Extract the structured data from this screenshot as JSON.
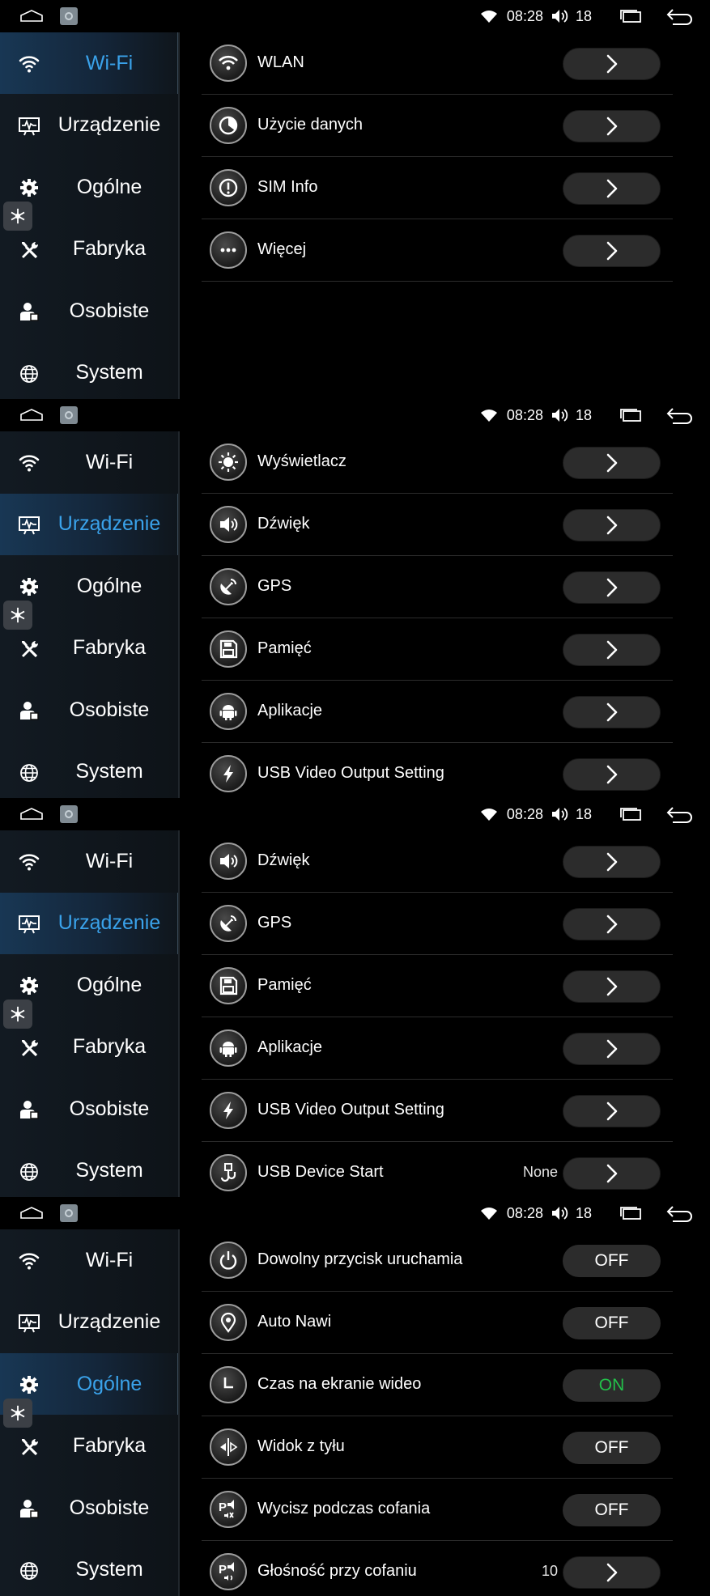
{
  "status_bar": {
    "time": "08:28",
    "volume": "18"
  },
  "nav": [
    "Wi-Fi",
    "Urządzenie",
    "Ogólne",
    "Fabryka",
    "Osobiste",
    "System"
  ],
  "panels": [
    {
      "active_nav": "Wi-Fi",
      "rows": [
        {
          "label": "WLAN",
          "icon": "wifi-icon",
          "control": "arrow"
        },
        {
          "label": "Użycie danych",
          "icon": "data-usage-icon",
          "control": "arrow"
        },
        {
          "label": "SIM Info",
          "icon": "info-icon",
          "control": "arrow"
        },
        {
          "label": "Więcej",
          "icon": "more-icon",
          "control": "arrow"
        }
      ]
    },
    {
      "active_nav": "Urządzenie",
      "rows": [
        {
          "label": "Wyświetlacz",
          "icon": "display-icon",
          "control": "arrow"
        },
        {
          "label": "Dźwięk",
          "icon": "sound-icon",
          "control": "arrow"
        },
        {
          "label": "GPS",
          "icon": "gps-icon",
          "control": "arrow"
        },
        {
          "label": "Pamięć",
          "icon": "storage-icon",
          "control": "arrow"
        },
        {
          "label": "Aplikacje",
          "icon": "android-icon",
          "control": "arrow"
        },
        {
          "label": "USB Video Output Setting",
          "icon": "usb-video-icon",
          "control": "arrow"
        }
      ]
    },
    {
      "active_nav": "Urządzenie",
      "rows": [
        {
          "label": "Dźwięk",
          "icon": "sound-icon",
          "control": "arrow"
        },
        {
          "label": "GPS",
          "icon": "gps-icon",
          "control": "arrow"
        },
        {
          "label": "Pamięć",
          "icon": "storage-icon",
          "control": "arrow"
        },
        {
          "label": "Aplikacje",
          "icon": "android-icon",
          "control": "arrow"
        },
        {
          "label": "USB Video Output Setting",
          "icon": "usb-video-icon",
          "control": "arrow"
        },
        {
          "label": "USB Device Start",
          "icon": "usb-icon",
          "control": "arrow",
          "value": "None"
        }
      ]
    },
    {
      "active_nav": "Ogólne",
      "rows": [
        {
          "label": "Dowolny przycisk uruchamia",
          "icon": "power-icon",
          "control": "toggle",
          "value": "OFF"
        },
        {
          "label": "Auto Nawi",
          "icon": "location-icon",
          "control": "toggle",
          "value": "OFF"
        },
        {
          "label": "Czas na ekranie wideo",
          "icon": "clock-icon",
          "control": "toggle",
          "value": "ON"
        },
        {
          "label": "Widok z tyłu",
          "icon": "mirror-icon",
          "control": "toggle",
          "value": "OFF"
        },
        {
          "label": "Wycisz podczas cofania",
          "icon": "parking-mute-icon",
          "control": "toggle",
          "value": "OFF"
        },
        {
          "label": "Głośność przy cofaniu",
          "icon": "parking-volume-icon",
          "control": "arrow",
          "value": "10"
        }
      ]
    }
  ]
}
